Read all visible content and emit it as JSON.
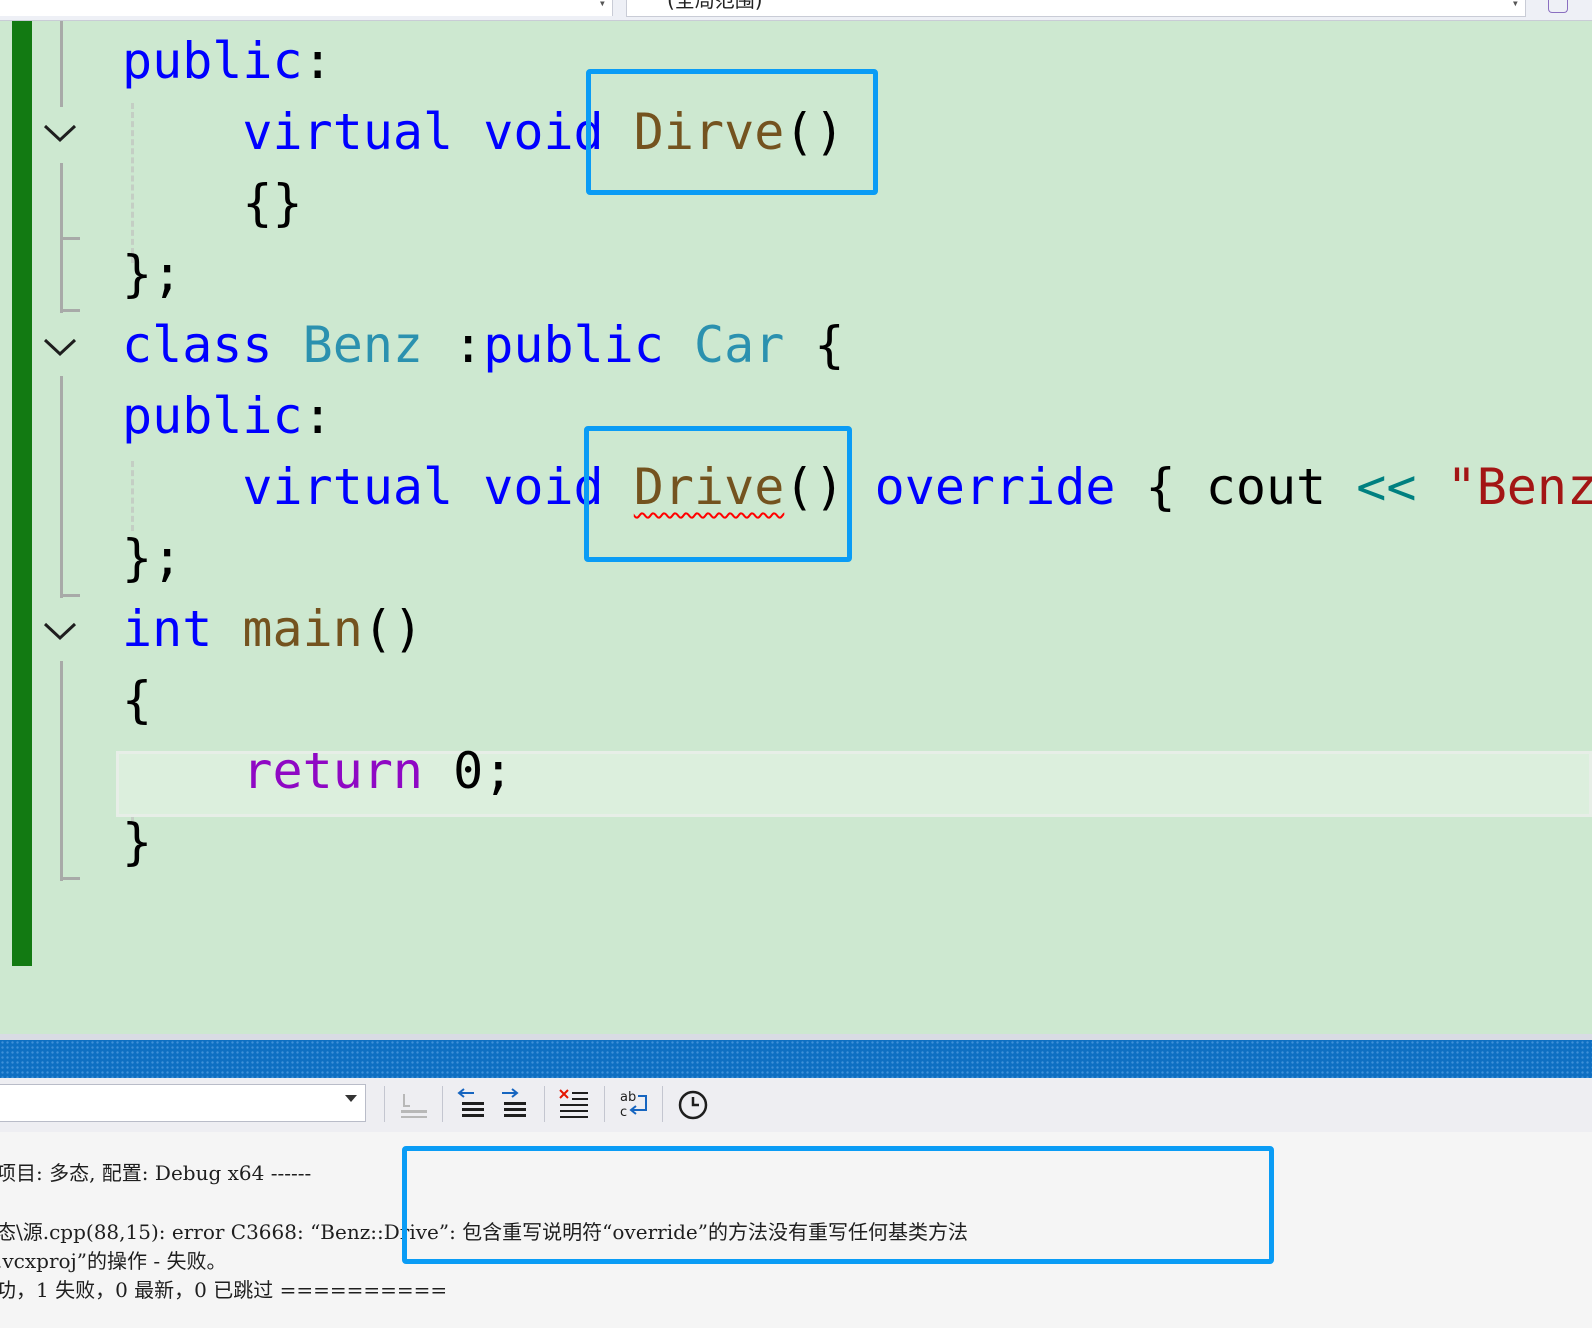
{
  "nav": {
    "scope_label": "(全局范围)"
  },
  "editor": {
    "lines": [
      {
        "tokens": [
          [
            "kw",
            "public"
          ],
          [
            "pl",
            ":"
          ]
        ]
      },
      {
        "tokens": [
          [
            "pl",
            "    "
          ],
          [
            "kw",
            "virtual"
          ],
          [
            "pl",
            " "
          ],
          [
            "kw",
            "void"
          ],
          [
            "pl",
            " "
          ],
          [
            "fn",
            "Dirve"
          ],
          [
            "pl",
            "()"
          ]
        ]
      },
      {
        "tokens": [
          [
            "pl",
            "    {}"
          ]
        ]
      },
      {
        "tokens": [
          [
            "pl",
            "};"
          ]
        ]
      },
      {
        "tokens": [
          [
            "kw",
            "class"
          ],
          [
            "pl",
            " "
          ],
          [
            "ty",
            "Benz"
          ],
          [
            "pl",
            " :"
          ],
          [
            "kw",
            "public"
          ],
          [
            "pl",
            " "
          ],
          [
            "ty",
            "Car"
          ],
          [
            "pl",
            " {"
          ]
        ]
      },
      {
        "tokens": [
          [
            "kw",
            "public"
          ],
          [
            "pl",
            ":"
          ]
        ]
      },
      {
        "tokens": [
          [
            "pl",
            "    "
          ],
          [
            "kw",
            "virtual"
          ],
          [
            "pl",
            " "
          ],
          [
            "kw",
            "void"
          ],
          [
            "pl",
            " "
          ],
          [
            "fnerr",
            "Drive"
          ],
          [
            "pl",
            "() "
          ],
          [
            "kw",
            "override"
          ],
          [
            "pl",
            " { cout "
          ],
          [
            "op",
            "<<"
          ],
          [
            "pl",
            " "
          ],
          [
            "str",
            "\"Benz"
          ]
        ]
      },
      {
        "tokens": [
          [
            "pl",
            "};"
          ]
        ]
      },
      {
        "tokens": [
          [
            "kw",
            "int"
          ],
          [
            "pl",
            " "
          ],
          [
            "fn",
            "main"
          ],
          [
            "pl",
            "()"
          ]
        ]
      },
      {
        "tokens": [
          [
            "pl",
            "{"
          ]
        ]
      },
      {
        "tokens": [
          [
            "pl",
            "    "
          ],
          [
            "kw2",
            "return"
          ],
          [
            "pl",
            " 0;"
          ]
        ]
      },
      {
        "tokens": [
          [
            "pl",
            "}"
          ]
        ]
      }
    ]
  },
  "output": {
    "lines": [
      "项目: 多态, 配置: Debug x64 ------",
      "",
      "态\\源.cpp(88,15): error C3668: “Benz::Drive”: 包含重写说明符“override”的方法没有重写任何基类方法",
      ".vcxproj”的操作 - 失败。",
      "功，1 失败，0 最新，0 已跳过 =========="
    ]
  },
  "colors": {
    "keyword": "#0000ff",
    "type": "#2b91af",
    "function": "#74531f",
    "string": "#a31515",
    "control": "#8f08c4",
    "editor_bg": "#cde8d0",
    "change_bar": "#127a12",
    "highlight_box": "#0a9cf5",
    "output_title": "#0e6fc2"
  },
  "icons": [
    "chevron-down-icon",
    "find-message-icon",
    "previous-message-icon",
    "next-message-icon",
    "clear-all-icon",
    "toggle-word-wrap-icon",
    "clock-icon"
  ]
}
